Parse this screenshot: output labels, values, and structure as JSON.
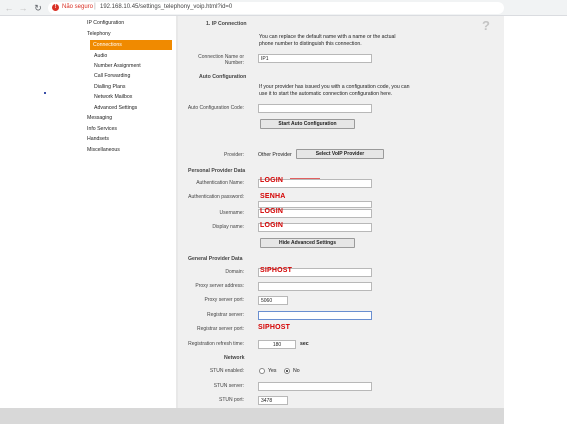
{
  "browser": {
    "insecure_label": "Não seguro",
    "url": "192.168.10.45/settings_telephony_voip.html?id=0"
  },
  "sidebar": {
    "items": [
      {
        "label": "IP Configuration"
      },
      {
        "label": "Telephony"
      },
      {
        "label": "Connections"
      },
      {
        "label": "Audio"
      },
      {
        "label": "Number Assignment"
      },
      {
        "label": "Call Forwarding"
      },
      {
        "label": "Dialling Plans"
      },
      {
        "label": "Network Mailbox"
      },
      {
        "label": "Advanced Settings"
      },
      {
        "label": "Messaging"
      },
      {
        "label": "Info Services"
      },
      {
        "label": "Handsets"
      },
      {
        "label": "Miscellaneous"
      }
    ]
  },
  "help_icon": "?",
  "ip_connection": {
    "title": "1. IP Connection",
    "description": "You can replace the default name with a name or the actual phone number to distinguish this connection.",
    "name_label_1": "Connection Name or",
    "name_label_2": "Number:",
    "name_value": "IP1"
  },
  "auto_config": {
    "title": "Auto Configuration",
    "description": "If your provider has issued you with a configuration code, you can use it to start the automatic connection configuration here.",
    "code_label": "Auto Configuration Code:",
    "code_value": "",
    "start_button": "Start Auto Configuration"
  },
  "provider": {
    "label": "Provider:",
    "value": "Other Provider",
    "select_button": "Select VoIP Provider"
  },
  "personal": {
    "title": "Personal Provider Data",
    "auth_name_label": "Authentication Name:",
    "auth_name_value": "LOGIN",
    "auth_pass_label": "Authentication password:",
    "auth_pass_value": "SENHA",
    "username_label": "Username:",
    "username_value": "LOGIN",
    "display_label": "Display name:",
    "display_value": "LOGIN",
    "hide_button": "Hide Advanced Settings"
  },
  "general": {
    "title": "General Provider Data",
    "domain_label": "Domain:",
    "domain_value": "SIPHOST",
    "proxy_addr_label": "Proxy server address:",
    "proxy_addr_value": "",
    "proxy_port_label": "Proxy server port:",
    "proxy_port_value": "5060",
    "registrar_label": "Registrar server:",
    "registrar_value": "",
    "registrar_port_label": "Registrar server port:",
    "registrar_port_value": "SIPHOST",
    "refresh_label": "Registration refresh time:",
    "refresh_value": "180",
    "refresh_unit": "sec"
  },
  "network": {
    "title": "Network",
    "stun_enabled_label": "STUN enabled:",
    "yes_label": "Yes",
    "no_label": "No",
    "stun_enabled": "no",
    "stun_server_label": "STUN server:",
    "stun_server_value": "",
    "stun_port_label": "STUN port:",
    "stun_port_value": "3478"
  },
  "colors": {
    "accent": "#f08a00",
    "annotation": "#d40000"
  }
}
